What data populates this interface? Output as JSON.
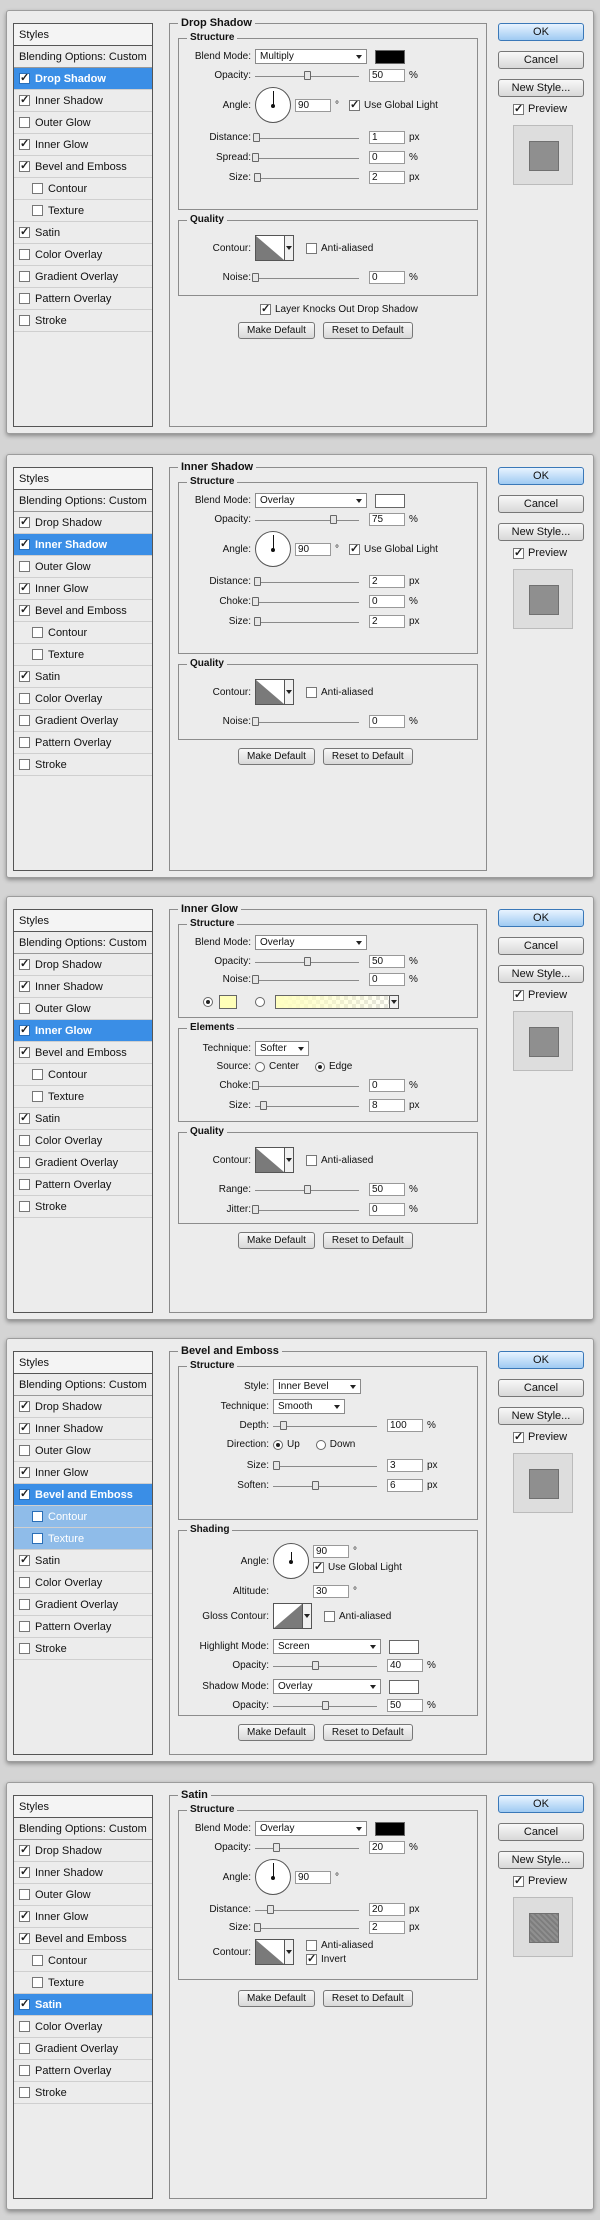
{
  "styles_header": "Styles",
  "blending_options": "Blending Options: Custom",
  "buttons": {
    "ok": "OK",
    "cancel": "Cancel",
    "new_style": "New Style...",
    "preview": "Preview",
    "make_default": "Make Default",
    "reset_default": "Reset to Default"
  },
  "common": {
    "structure": "Structure",
    "quality": "Quality",
    "elements": "Elements",
    "shading": "Shading",
    "blend_mode": "Blend Mode:",
    "opacity": "Opacity:",
    "angle": "Angle:",
    "distance": "Distance:",
    "spread": "Spread:",
    "size": "Size:",
    "choke": "Choke:",
    "noise": "Noise:",
    "contour": "Contour:",
    "anti_aliased": "Anti-aliased",
    "use_global_light": "Use Global Light",
    "technique": "Technique:",
    "source": "Source:",
    "center": "Center",
    "edge": "Edge",
    "range": "Range:",
    "jitter": "Jitter:",
    "style": "Style:",
    "depth": "Depth:",
    "direction": "Direction:",
    "up": "Up",
    "down": "Down",
    "soften": "Soften:",
    "altitude": "Altitude:",
    "gloss_contour": "Gloss Contour:",
    "highlight_mode": "Highlight Mode:",
    "shadow_mode": "Shadow Mode:",
    "invert": "Invert",
    "layer_knocks": "Layer Knocks Out Drop Shadow",
    "px": "px",
    "pct": "%",
    "deg": "°"
  },
  "style_items": [
    {
      "label": "Drop Shadow",
      "checked": true,
      "sub": false
    },
    {
      "label": "Inner Shadow",
      "checked": true,
      "sub": false
    },
    {
      "label": "Outer Glow",
      "checked": false,
      "sub": false
    },
    {
      "label": "Inner Glow",
      "checked": true,
      "sub": false
    },
    {
      "label": "Bevel and Emboss",
      "checked": true,
      "sub": false
    },
    {
      "label": "Contour",
      "checked": false,
      "sub": true
    },
    {
      "label": "Texture",
      "checked": false,
      "sub": true
    },
    {
      "label": "Satin",
      "checked": true,
      "sub": false
    },
    {
      "label": "Color Overlay",
      "checked": false,
      "sub": false
    },
    {
      "label": "Gradient Overlay",
      "checked": false,
      "sub": false
    },
    {
      "label": "Pattern Overlay",
      "checked": false,
      "sub": false
    },
    {
      "label": "Stroke",
      "checked": false,
      "sub": false
    }
  ],
  "colors": {
    "black": "#000000",
    "white": "#ffffff",
    "glow": "#ffffb8"
  },
  "drop_shadow": {
    "title": "Drop Shadow",
    "selected_index": 0,
    "blend_mode": "Multiply",
    "opacity": "50",
    "opacity_level": 0.5,
    "angle": "90",
    "distance": "1",
    "distance_level": 0.01,
    "spread": "0",
    "spread_level": 0,
    "size": "2",
    "size_level": 0.02,
    "noise": "0",
    "noise_level": 0
  },
  "inner_shadow": {
    "title": "Inner Shadow",
    "selected_index": 1,
    "blend_mode": "Overlay",
    "opacity": "75",
    "opacity_level": 0.75,
    "angle": "90",
    "distance": "2",
    "distance_level": 0.02,
    "choke": "0",
    "choke_level": 0,
    "size": "2",
    "size_level": 0.02,
    "noise": "0",
    "noise_level": 0
  },
  "inner_glow": {
    "title": "Inner Glow",
    "selected_index": 3,
    "blend_mode": "Overlay",
    "opacity": "50",
    "opacity_level": 0.5,
    "noise": "0",
    "noise_level": 0,
    "technique": "Softer",
    "choke": "0",
    "choke_level": 0,
    "size": "8",
    "size_level": 0.08,
    "range": "50",
    "range_level": 0.5,
    "jitter": "0",
    "jitter_level": 0
  },
  "bevel_emboss": {
    "title": "Bevel and Emboss",
    "selected_index": 4,
    "style": "Inner Bevel",
    "technique": "Smooth",
    "depth": "100",
    "depth_level": 0.1,
    "size": "3",
    "size_level": 0.03,
    "soften": "6",
    "soften_level": 0.4,
    "angle": "90",
    "altitude": "30",
    "highlight_mode": "Screen",
    "highlight_opacity": "40",
    "highlight_opacity_level": 0.4,
    "shadow_mode": "Overlay",
    "shadow_opacity": "50",
    "shadow_opacity_level": 0.5
  },
  "satin": {
    "title": "Satin",
    "selected_index": 7,
    "blend_mode": "Overlay",
    "opacity": "20",
    "opacity_level": 0.2,
    "angle": "90",
    "distance": "20",
    "distance_level": 0.14,
    "size": "2",
    "size_level": 0.02
  }
}
